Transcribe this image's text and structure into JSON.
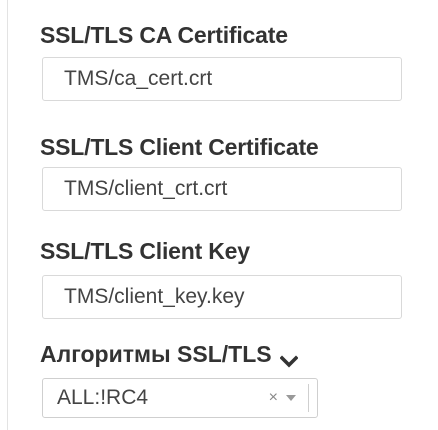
{
  "fields": [
    {
      "label": "SSL/TLS CA Certificate",
      "value": "TMS/ca_cert.crt"
    },
    {
      "label": "SSL/TLS Client Certificate",
      "value": "TMS/client_crt.crt"
    },
    {
      "label": "SSL/TLS Client Key",
      "value": "TMS/client_key.key"
    }
  ],
  "algorithms": {
    "label": "Алгоритмы SSL/TLS",
    "toggle_icon": "chevron-down-icon",
    "selected": "ALL:!RC4",
    "clear_glyph": "×"
  }
}
